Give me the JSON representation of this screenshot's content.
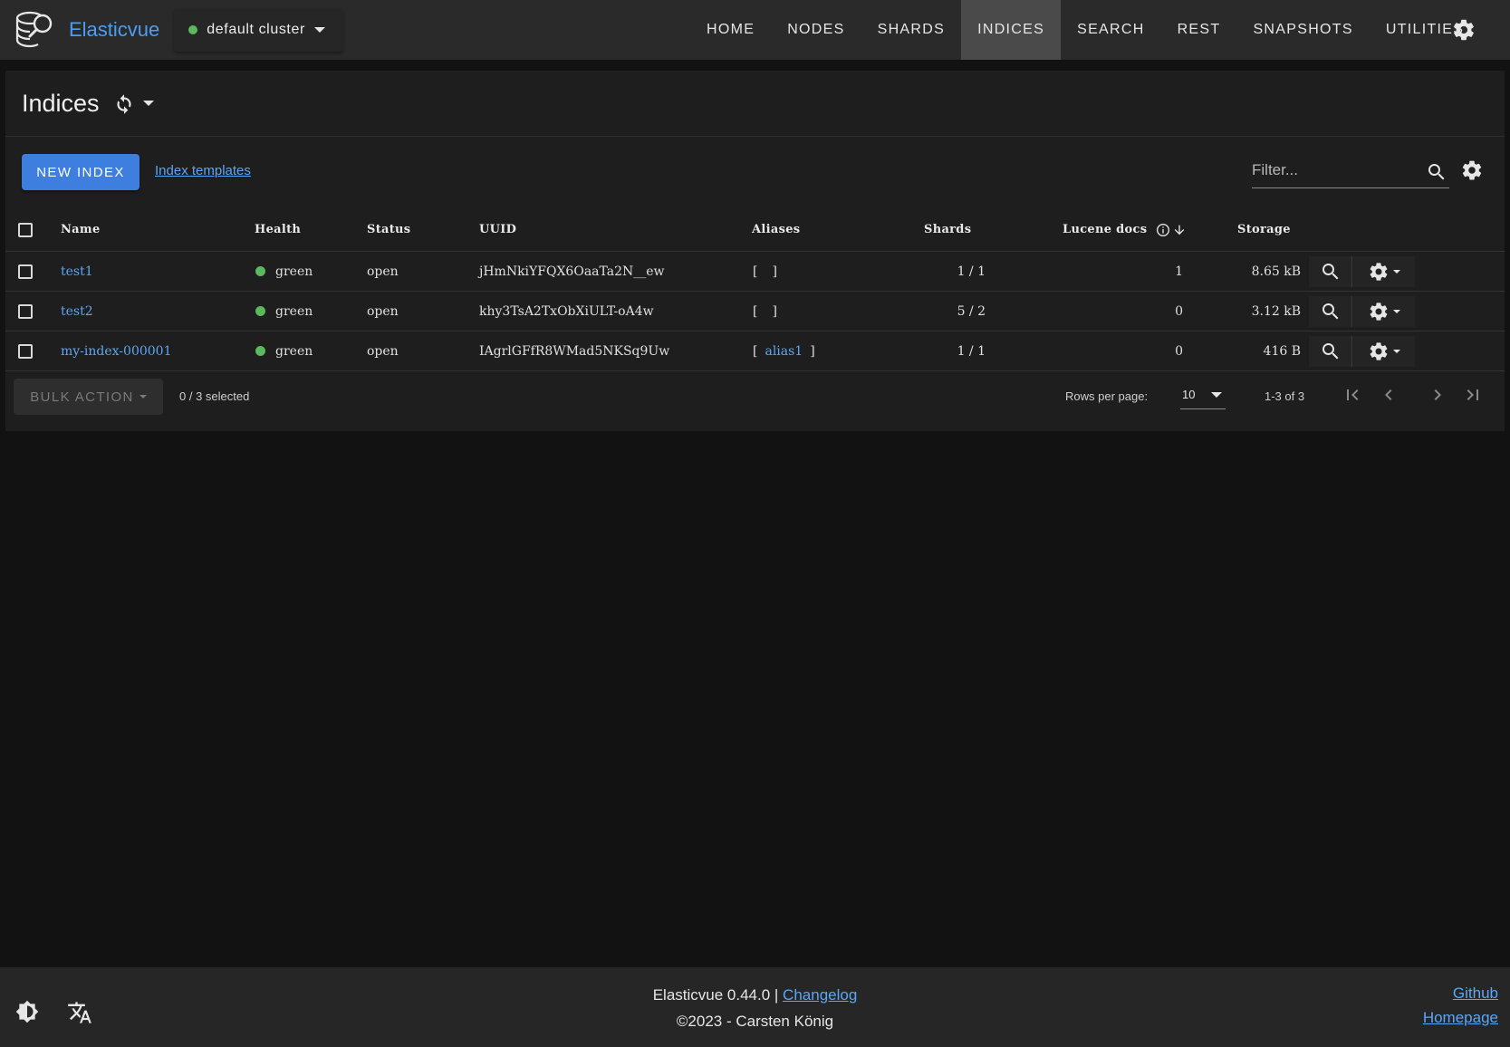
{
  "app": {
    "name": "Elasticvue",
    "cluster": "default cluster",
    "cluster_status_color": "#5cb85c"
  },
  "nav": {
    "items": [
      {
        "label": "HOME"
      },
      {
        "label": "NODES"
      },
      {
        "label": "SHARDS"
      },
      {
        "label": "INDICES",
        "active": true
      },
      {
        "label": "SEARCH"
      },
      {
        "label": "REST"
      },
      {
        "label": "SNAPSHOTS"
      },
      {
        "label": "UTILITIES"
      }
    ]
  },
  "page": {
    "title": "Indices",
    "new_index_label": "NEW INDEX",
    "templates_link": "Index templates",
    "filter_placeholder": "Filter..."
  },
  "table": {
    "headers": {
      "name": "Name",
      "health": "Health",
      "status": "Status",
      "uuid": "UUID",
      "aliases": "Aliases",
      "shards": "Shards",
      "lucene_docs": "Lucene docs",
      "storage": "Storage"
    },
    "rows": [
      {
        "name": "test1",
        "health": "green",
        "status": "open",
        "uuid": "jHmNkiYFQX6OaaTa2N__ew",
        "alias_open": "[",
        "alias": "",
        "alias_close": "]",
        "shards": "1 / 1",
        "docs": "1",
        "storage": "8.65 kB"
      },
      {
        "name": "test2",
        "health": "green",
        "status": "open",
        "uuid": "khy3TsA2TxObXiULT-oA4w",
        "alias_open": "[",
        "alias": "",
        "alias_close": "]",
        "shards": "5 / 2",
        "docs": "0",
        "storage": "3.12 kB"
      },
      {
        "name": "my-index-000001",
        "health": "green",
        "status": "open",
        "uuid": "IAgrlGFfR8WMad5NKSq9Uw",
        "alias_open": "[",
        "alias": "alias1",
        "alias_close": "]",
        "shards": "1 / 1",
        "docs": "0",
        "storage": "416 B"
      }
    ],
    "health_color": "#5cb85c"
  },
  "footer_bar": {
    "bulk_action": "BULK ACTION",
    "selected": "0 / 3 selected",
    "rows_per_page_label": "Rows per page:",
    "rows_per_page": "10",
    "range": "1-3 of 3"
  },
  "app_footer": {
    "version": "Elasticvue 0.44.0 |",
    "changelog": "Changelog",
    "copyright": "©2023 - Carsten König",
    "github": "Github",
    "homepage": "Homepage"
  },
  "icons": [
    "elasticvue-logo-icon",
    "gear-icon",
    "reload-icon",
    "search-icon",
    "info-icon",
    "arrow-down-icon",
    "first-page-icon",
    "prev-page-icon",
    "next-page-icon",
    "last-page-icon",
    "theme-icon",
    "translate-icon"
  ],
  "colors": {
    "accent": "#3d7ede",
    "link": "#5aa6f7",
    "topbar": "#2a2a2a",
    "card": "#1e1e1e",
    "background": "#121212"
  }
}
